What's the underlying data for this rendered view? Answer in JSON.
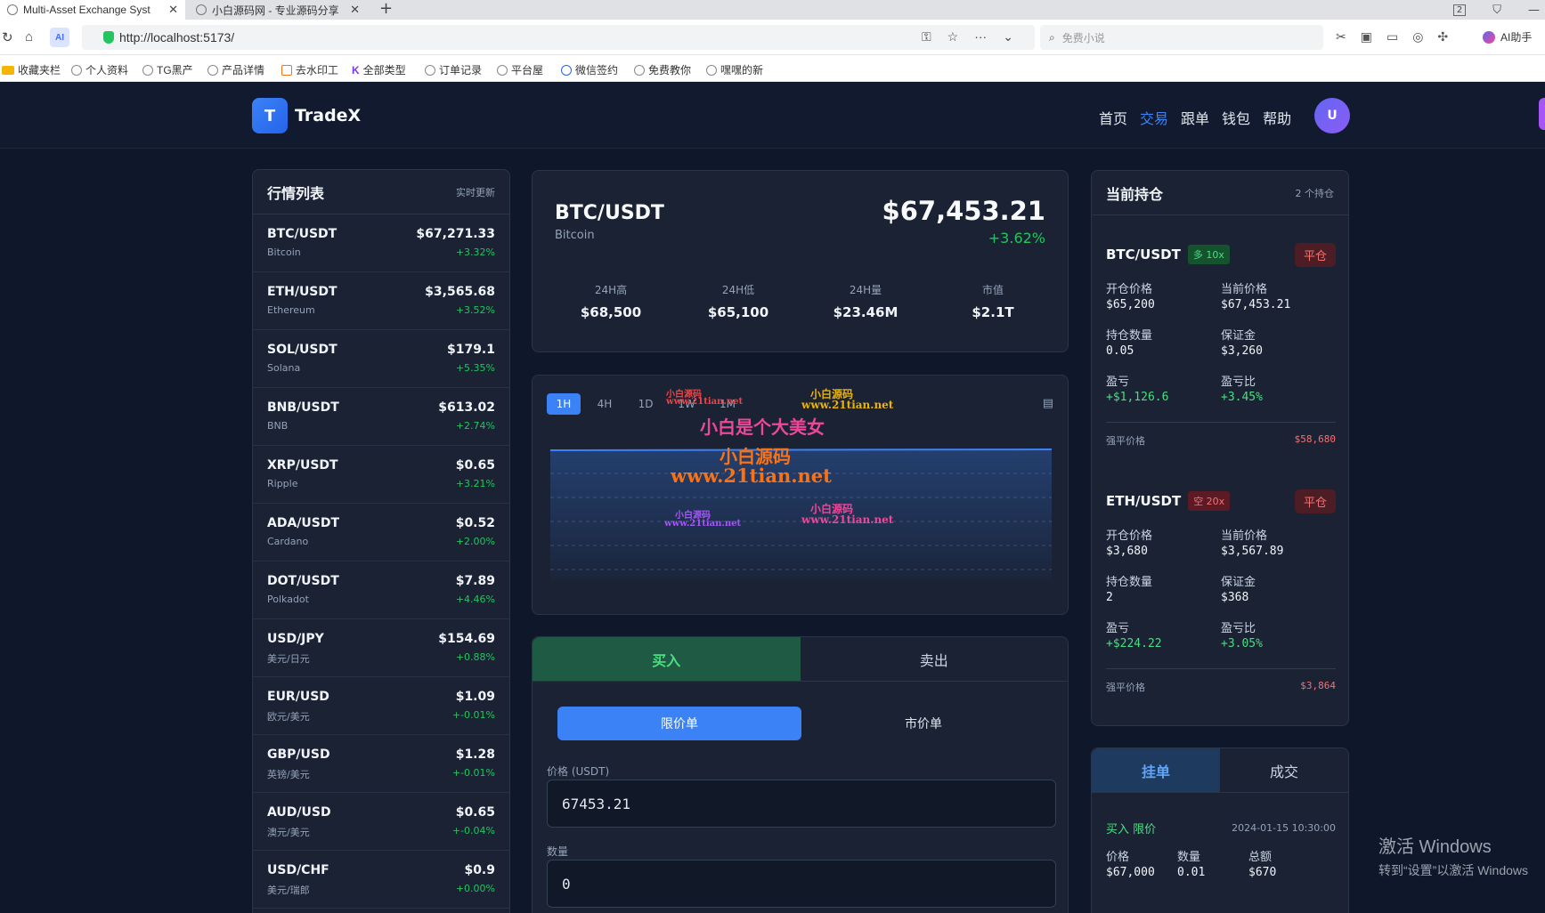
{
  "browser": {
    "tabs": [
      {
        "title": "Multi-Asset Exchange Syst"
      },
      {
        "title": "小白源码网 - 专业源码分享"
      }
    ],
    "new_tab": "+",
    "window_badge": "2",
    "url": "http://localhost:5173/",
    "ai_badge": "AI",
    "search_placeholder": "免费小说",
    "ai_helper": "AI助手",
    "bookmarks": [
      "收藏夹栏",
      "个人资料",
      "TG黑产",
      "产品详情",
      "去水印工",
      "全部类型",
      "订单记录",
      "平台屋",
      "微信签约",
      "免费教你",
      "嘿嘿的新"
    ]
  },
  "header": {
    "logo_letter": "T",
    "brand": "TradeX",
    "nav": [
      "首页",
      "交易",
      "跟单",
      "钱包",
      "帮助"
    ],
    "active_nav": "交易",
    "avatar": "U"
  },
  "market": {
    "title": "行情列表",
    "subtitle": "实时更新",
    "rows": [
      {
        "symbol": "BTC/USDT",
        "name": "Bitcoin",
        "price": "$67,271.33",
        "change": "+3.32%"
      },
      {
        "symbol": "ETH/USDT",
        "name": "Ethereum",
        "price": "$3,565.68",
        "change": "+3.52%"
      },
      {
        "symbol": "SOL/USDT",
        "name": "Solana",
        "price": "$179.1",
        "change": "+5.35%"
      },
      {
        "symbol": "BNB/USDT",
        "name": "BNB",
        "price": "$613.02",
        "change": "+2.74%"
      },
      {
        "symbol": "XRP/USDT",
        "name": "Ripple",
        "price": "$0.65",
        "change": "+3.21%"
      },
      {
        "symbol": "ADA/USDT",
        "name": "Cardano",
        "price": "$0.52",
        "change": "+2.00%"
      },
      {
        "symbol": "DOT/USDT",
        "name": "Polkadot",
        "price": "$7.89",
        "change": "+4.46%"
      },
      {
        "symbol": "USD/JPY",
        "name": "美元/日元",
        "price": "$154.69",
        "change": "+0.88%"
      },
      {
        "symbol": "EUR/USD",
        "name": "欧元/美元",
        "price": "$1.09",
        "change": "+-0.01%"
      },
      {
        "symbol": "GBP/USD",
        "name": "英镑/美元",
        "price": "$1.28",
        "change": "+-0.01%"
      },
      {
        "symbol": "AUD/USD",
        "name": "澳元/美元",
        "price": "$0.65",
        "change": "+-0.04%"
      },
      {
        "symbol": "USD/CHF",
        "name": "美元/瑞郎",
        "price": "$0.9",
        "change": "+0.00%"
      }
    ]
  },
  "ticker": {
    "symbol": "BTC/USDT",
    "name": "Bitcoin",
    "price": "$67,453.21",
    "change": "+3.62%",
    "stats": [
      {
        "label": "24H高",
        "value": "$68,500"
      },
      {
        "label": "24H低",
        "value": "$65,100"
      },
      {
        "label": "24H量",
        "value": "$23.46M"
      },
      {
        "label": "市值",
        "value": "$2.1T"
      }
    ]
  },
  "chart": {
    "timeframes": [
      "1H",
      "4H",
      "1D",
      "1W",
      "1M"
    ],
    "active_timeframe": "1H",
    "settings_icon": "layout-icon",
    "line_color": "#3b82f6",
    "watermarks": [
      {
        "text": "小白源码",
        "color": "#ef4444"
      },
      {
        "text": "www.21tian.net",
        "color": "#ef4444"
      },
      {
        "text": "小白源码",
        "color": "#eab308"
      },
      {
        "text": "www.21tian.net",
        "color": "#eab308"
      },
      {
        "text": "小白是个大美女",
        "color": "#ec4899"
      },
      {
        "text": "小白源码",
        "color": "#f97316"
      },
      {
        "text": "www.21tian.net",
        "color": "#f97316"
      },
      {
        "text": "小白源码",
        "color": "#a855f7"
      },
      {
        "text": "www.21tian.net",
        "color": "#a855f7"
      },
      {
        "text": "小白源码",
        "color": "#ec4899"
      },
      {
        "text": "www.21tian.net",
        "color": "#ec4899"
      }
    ]
  },
  "order_form": {
    "buy_label": "买入",
    "sell_label": "卖出",
    "limit_label": "限价单",
    "market_label": "市价单",
    "price_label": "价格 (USDT)",
    "price_value": "67453.21",
    "qty_label": "数量",
    "qty_value": "0"
  },
  "positions": {
    "title": "当前持仓",
    "count": "2 个持仓",
    "items": [
      {
        "symbol": "BTC/USDT",
        "leverage": "多 10x",
        "side": "long",
        "close_label": "平仓",
        "open_price_label": "开仓价格",
        "open_price": "$65,200",
        "current_price_label": "当前价格",
        "current_price": "$67,453.21",
        "qty_label": "持仓数量",
        "qty": "0.05",
        "margin_label": "保证金",
        "margin": "$3,260",
        "pnl_label": "盈亏",
        "pnl": "+$1,126.6",
        "pnl_pct_label": "盈亏比",
        "pnl_pct": "+3.45%",
        "liq_label": "强平价格",
        "liq_price": "$58,680"
      },
      {
        "symbol": "ETH/USDT",
        "leverage": "空 20x",
        "side": "short",
        "close_label": "平仓",
        "open_price_label": "开仓价格",
        "open_price": "$3,680",
        "current_price_label": "当前价格",
        "current_price": "$3,567.89",
        "qty_label": "持仓数量",
        "qty": "2",
        "margin_label": "保证金",
        "margin": "$368",
        "pnl_label": "盈亏",
        "pnl": "+$224.22",
        "pnl_pct_label": "盈亏比",
        "pnl_pct": "+3.05%",
        "liq_label": "强平价格",
        "liq_price": "$3,864"
      }
    ]
  },
  "orders": {
    "tabs": [
      "挂单",
      "成交"
    ],
    "item": {
      "side": "买入 限价",
      "time": "2024-01-15 10:30:00",
      "price_label": "价格",
      "price": "$67,000",
      "qty_label": "数量",
      "qty": "0.01",
      "total_label": "总额",
      "total": "$670"
    }
  },
  "os": {
    "activate_title": "激活 Windows",
    "activate_sub": "转到“设置”以激活 Windows"
  }
}
